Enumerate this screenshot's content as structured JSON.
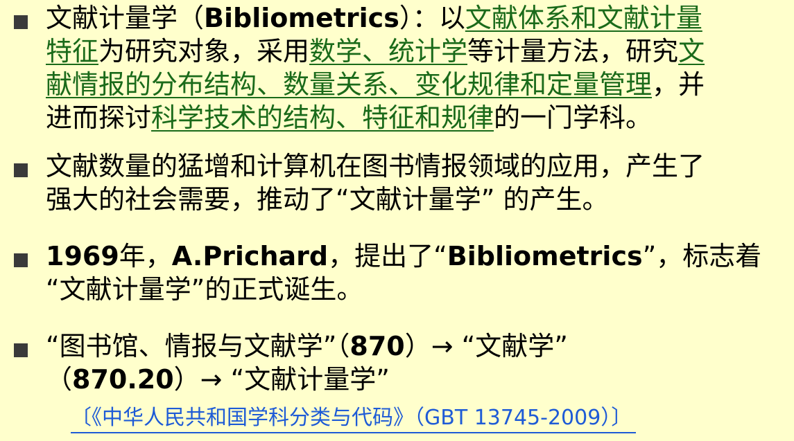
{
  "bullets": [
    {
      "lines": [
        [
          {
            "text": "文献计量学（",
            "style": "plain"
          },
          {
            "text": "Bibliometrics",
            "style": "bold"
          },
          {
            "text": "）：以",
            "style": "plain"
          },
          {
            "text": "文献体系和文献计量",
            "style": "link"
          }
        ],
        [
          {
            "text": "特征",
            "style": "link"
          },
          {
            "text": "为研究对象，采用",
            "style": "plain"
          },
          {
            "text": "数学、统计学",
            "style": "link"
          },
          {
            "text": "等计量方法，研究",
            "style": "plain"
          },
          {
            "text": "文",
            "style": "link"
          }
        ],
        [
          {
            "text": "献情报的分布结构、数量关系、变化规律和定量管理",
            "style": "link"
          },
          {
            "text": "，并",
            "style": "plain"
          }
        ],
        [
          {
            "text": "进而探讨",
            "style": "plain"
          },
          {
            "text": "科学技术的结构、特征和规律",
            "style": "link"
          },
          {
            "text": "的一门学科。",
            "style": "plain"
          }
        ]
      ]
    },
    {
      "lines": [
        [
          {
            "text": "文献数量的猛增和计算机在图书情报领域的应用，产生了",
            "style": "plain"
          }
        ],
        [
          {
            "text": "强大的社会需要，推动了“文献计量学” 的产生。",
            "style": "plain"
          }
        ]
      ]
    },
    {
      "lines": [
        [
          {
            "text": "1969",
            "style": "bold"
          },
          {
            "text": "年，",
            "style": "plain"
          },
          {
            "text": "A.Prichard",
            "style": "bold"
          },
          {
            "text": "，提出了“",
            "style": "plain"
          },
          {
            "text": "Bibliometrics",
            "style": "bold"
          },
          {
            "text": "”，标志着",
            "style": "plain"
          }
        ],
        [
          {
            "text": "“文献计量学”的正式诞生。",
            "style": "plain"
          }
        ]
      ]
    },
    {
      "lines": [
        [
          {
            "text": " “图书馆、情报与文献学”（",
            "style": "plain"
          },
          {
            "text": "870",
            "style": "bold"
          },
          {
            "text": "）→ “文献学”",
            "style": "plain"
          }
        ],
        [
          {
            "text": " （",
            "style": "plain"
          },
          {
            "text": "870.20",
            "style": "bold"
          },
          {
            "text": "）→ “文献计量学”",
            "style": "plain"
          }
        ]
      ]
    }
  ],
  "reference": "〔《中华人民共和国学科分类与代码》（GBT 13745-2009）〕",
  "colors": {
    "background": "#ffffcc",
    "link": "#1a6a1a",
    "reference": "#1e5bd6",
    "marker": "#3a3a3a"
  }
}
